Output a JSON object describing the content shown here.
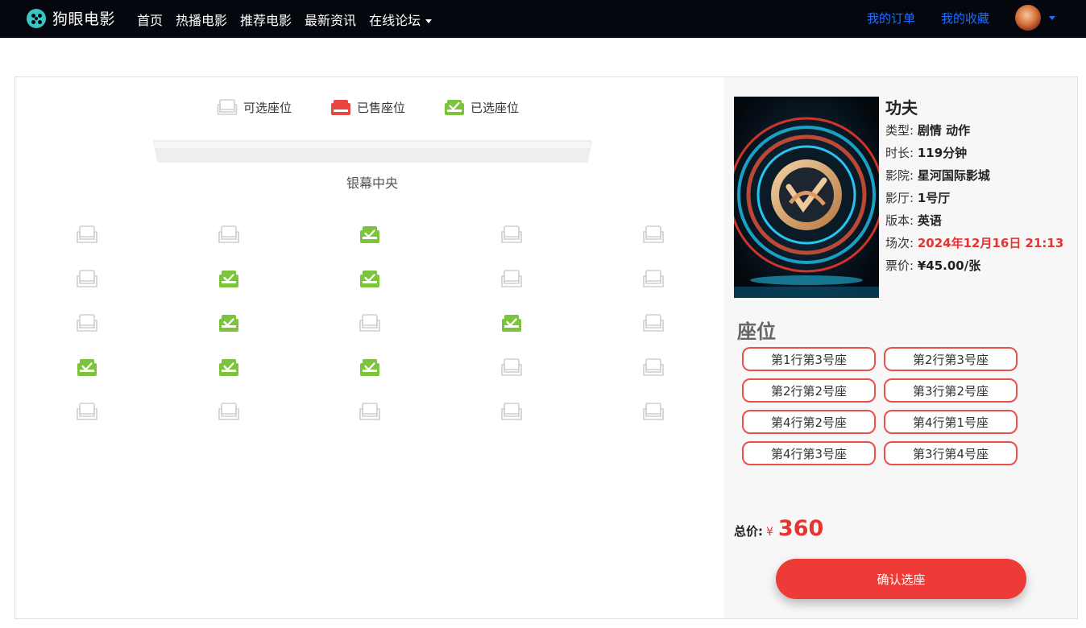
{
  "nav": {
    "brand": "狗眼电影",
    "links": [
      "首页",
      "热播电影",
      "推荐电影",
      "最新资讯",
      "在线论坛"
    ],
    "right_links": [
      "我的订单",
      "我的收藏"
    ]
  },
  "legend": {
    "available": "可选座位",
    "sold": "已售座位",
    "selected": "已选座位"
  },
  "screen_label": "银幕中央",
  "seat_map": [
    [
      "available",
      "available",
      "selected",
      "available",
      "available"
    ],
    [
      "available",
      "selected",
      "selected",
      "available",
      "available"
    ],
    [
      "available",
      "selected",
      "available",
      "selected",
      "available"
    ],
    [
      "selected",
      "selected",
      "selected",
      "available",
      "available"
    ],
    [
      "available",
      "available",
      "available",
      "available",
      "available"
    ]
  ],
  "movie": {
    "title": "功夫",
    "type_label": "类型:",
    "type": "剧情 动作",
    "duration_label": "时长:",
    "duration": "119分钟",
    "cinema_label": "影院:",
    "cinema": "星河国际影城",
    "hall_label": "影厅:",
    "hall": "1号厅",
    "version_label": "版本:",
    "version": "英语",
    "session_label": "场次:",
    "session": "2024年12月16日 21:13",
    "price_label": "票价:",
    "price": "¥45.00/张"
  },
  "seats_heading": "座位",
  "selected_seats": [
    "第1行第3号座",
    "第2行第3号座",
    "第2行第2号座",
    "第3行第2号座",
    "第4行第2号座",
    "第4行第1号座",
    "第4行第3号座",
    "第3行第4号座"
  ],
  "total": {
    "label": "总价:",
    "currency": "¥",
    "amount": "360"
  },
  "confirm_label": "确认选座",
  "colors": {
    "navbar": "#04070d",
    "link_blue": "#1e6fff",
    "sold_red": "#e8463f",
    "selected_green": "#7cc43c",
    "accent_red": "#ef3b37"
  }
}
